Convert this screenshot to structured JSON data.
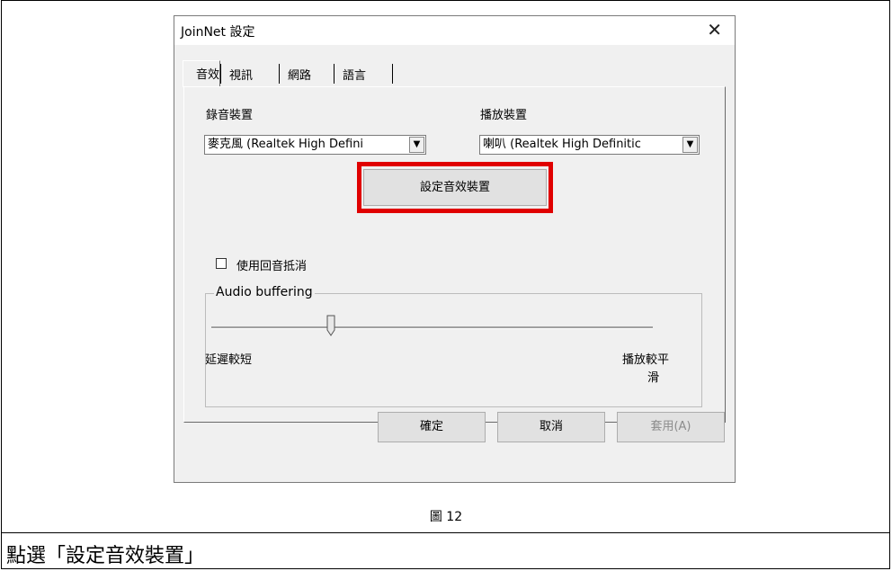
{
  "dialog": {
    "title": "JoinNet 設定",
    "close_glyph": "✕",
    "tabs": [
      {
        "label": "音效",
        "active": true
      },
      {
        "label": "視訊",
        "active": false
      },
      {
        "label": "網路",
        "active": false
      },
      {
        "label": "語言",
        "active": false
      }
    ],
    "audio": {
      "record_label": "錄音裝置",
      "record_value": "麥克風 (Realtek High Defini",
      "playback_label": "播放裝置",
      "playback_value": "喇叭 (Realtek High Definitic",
      "setup_button": "設定音效裝置",
      "echo_cancel_label": "使用回音抵消",
      "echo_cancel_checked": false,
      "buffering_group": "Audio buffering",
      "slider_left_label": "延遲較短",
      "slider_right_label_line1": "播放較平",
      "slider_right_label_line2": "滑",
      "slider_value": 0.27
    },
    "buttons": {
      "ok": "確定",
      "cancel": "取消",
      "apply": "套用(A)"
    }
  },
  "caption": "圖 12",
  "instruction": "點選「設定音效裝置」",
  "highlight_color": "#e00000"
}
